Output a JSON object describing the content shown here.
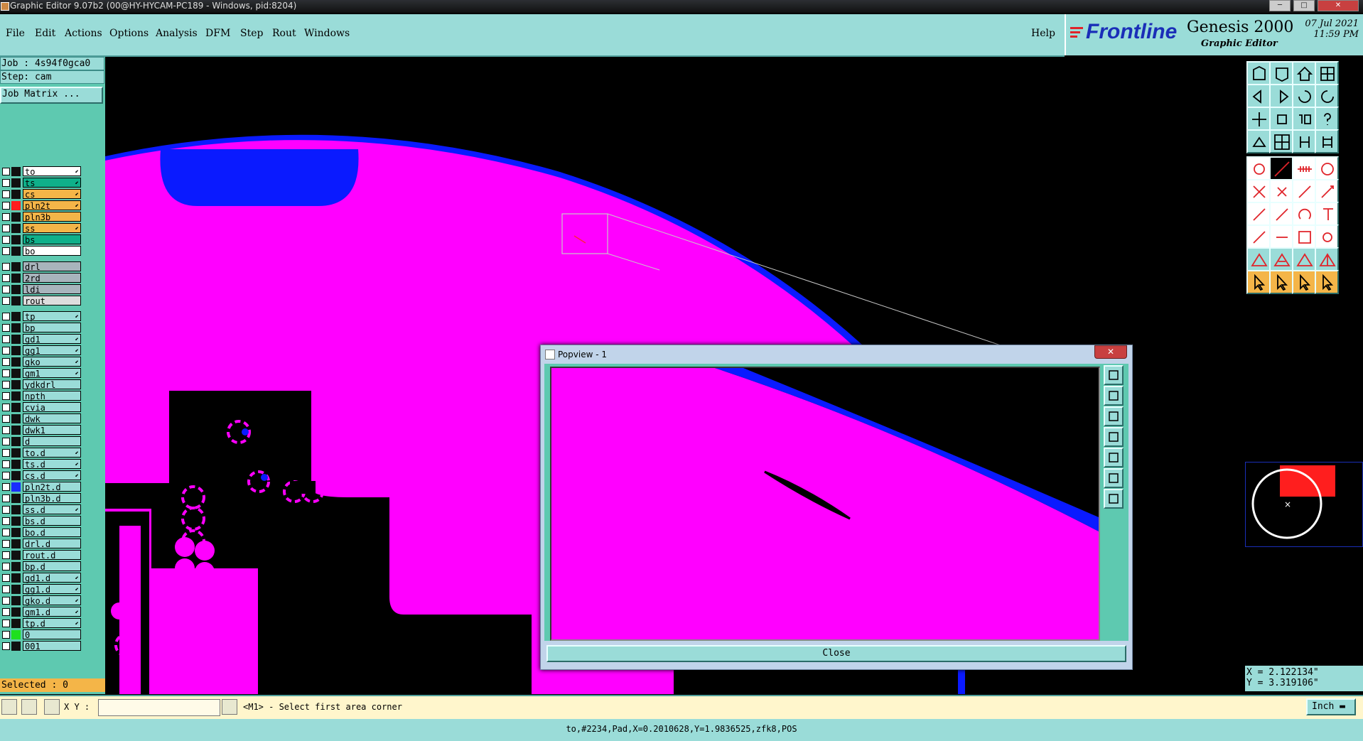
{
  "window": {
    "title": "Graphic Editor 9.07b2 (00@HY-HYCAM-PC189 - Windows, pid:8204)",
    "controls": [
      "─",
      "□",
      "✕"
    ]
  },
  "menu": {
    "items": [
      "File",
      "Edit",
      "Actions",
      "Options",
      "Analysis",
      "DFM",
      "Step",
      "Rout",
      "Windows"
    ],
    "help": "Help"
  },
  "brand": {
    "logo": "Frontline",
    "product": "Genesis 2000",
    "subtitle": "Graphic Editor",
    "date": "07 Jul 2021",
    "time": "11:59 PM"
  },
  "info": {
    "job": "Job : 4s94f0gca0",
    "step": "Step: cam",
    "matrix_button": "Job Matrix ..."
  },
  "layers": [
    {
      "name": "to",
      "color": "#ffffff",
      "swatch": "#111111",
      "arrow": true
    },
    {
      "name": "ts",
      "color": "#0fb08a",
      "swatch": "#111111",
      "arrow": true
    },
    {
      "name": "cs",
      "color": "#f4b548",
      "swatch": "#111111",
      "arrow": true
    },
    {
      "name": "pln2t",
      "color": "#f4b548",
      "swatch": "#ff1e1e",
      "arrow": true
    },
    {
      "name": "pln3b",
      "color": "#f4b548",
      "swatch": "#111111",
      "arrow": false
    },
    {
      "name": "ss",
      "color": "#f4b548",
      "swatch": "#111111",
      "arrow": true
    },
    {
      "name": "bs",
      "color": "#0fb08a",
      "swatch": "#111111",
      "arrow": false
    },
    {
      "name": "bo",
      "color": "#ffffff",
      "swatch": "#111111",
      "arrow": false
    },
    {
      "name": "drl",
      "color": "#a8b4bc",
      "swatch": "#111111",
      "arrow": false
    },
    {
      "name": "2rd",
      "color": "#a8b4bc",
      "swatch": "#111111",
      "arrow": false
    },
    {
      "name": "ldi",
      "color": "#a8b4bc",
      "swatch": "#111111",
      "arrow": false
    },
    {
      "name": "rout",
      "color": "#dddddd",
      "swatch": "#111111",
      "arrow": false
    },
    {
      "name": "tp",
      "color": "#9adcd8",
      "swatch": "#111111",
      "arrow": true
    },
    {
      "name": "bp",
      "color": "#9adcd8",
      "swatch": "#111111",
      "arrow": false
    },
    {
      "name": "gd1",
      "color": "#9adcd8",
      "swatch": "#111111",
      "arrow": true
    },
    {
      "name": "gg1",
      "color": "#9adcd8",
      "swatch": "#111111",
      "arrow": true
    },
    {
      "name": "gko",
      "color": "#9adcd8",
      "swatch": "#111111",
      "arrow": true
    },
    {
      "name": "gm1",
      "color": "#9adcd8",
      "swatch": "#111111",
      "arrow": true
    },
    {
      "name": "ydkdrl",
      "color": "#9adcd8",
      "swatch": "#111111",
      "arrow": false
    },
    {
      "name": "npth",
      "color": "#9adcd8",
      "swatch": "#111111",
      "arrow": false
    },
    {
      "name": "cvia",
      "color": "#9adcd8",
      "swatch": "#111111",
      "arrow": false
    },
    {
      "name": "dwk",
      "color": "#9adcd8",
      "swatch": "#111111",
      "arrow": false
    },
    {
      "name": "dwk1",
      "color": "#9adcd8",
      "swatch": "#111111",
      "arrow": false
    },
    {
      "name": "d",
      "color": "#9adcd8",
      "swatch": "#111111",
      "arrow": false
    },
    {
      "name": "to.d",
      "color": "#9adcd8",
      "swatch": "#111111",
      "arrow": true
    },
    {
      "name": "ts.d",
      "color": "#9adcd8",
      "swatch": "#111111",
      "arrow": true
    },
    {
      "name": "cs.d",
      "color": "#9adcd8",
      "swatch": "#111111",
      "arrow": true
    },
    {
      "name": "pln2t.d",
      "color": "#9adcd8",
      "swatch": "#1a2eff",
      "arrow": false
    },
    {
      "name": "pln3b.d",
      "color": "#9adcd8",
      "swatch": "#111111",
      "arrow": false
    },
    {
      "name": "ss.d",
      "color": "#9adcd8",
      "swatch": "#111111",
      "arrow": true
    },
    {
      "name": "bs.d",
      "color": "#9adcd8",
      "swatch": "#111111",
      "arrow": false
    },
    {
      "name": "bo.d",
      "color": "#9adcd8",
      "swatch": "#111111",
      "arrow": false
    },
    {
      "name": "drl.d",
      "color": "#9adcd8",
      "swatch": "#111111",
      "arrow": false
    },
    {
      "name": "rout.d",
      "color": "#9adcd8",
      "swatch": "#111111",
      "arrow": false
    },
    {
      "name": "bp.d",
      "color": "#9adcd8",
      "swatch": "#111111",
      "arrow": false
    },
    {
      "name": "gd1.d",
      "color": "#9adcd8",
      "swatch": "#111111",
      "arrow": true
    },
    {
      "name": "gg1.d",
      "color": "#9adcd8",
      "swatch": "#111111",
      "arrow": true
    },
    {
      "name": "gko.d",
      "color": "#9adcd8",
      "swatch": "#111111",
      "arrow": true
    },
    {
      "name": "gm1.d",
      "color": "#9adcd8",
      "swatch": "#111111",
      "arrow": true
    },
    {
      "name": "tp.d",
      "color": "#9adcd8",
      "swatch": "#111111",
      "arrow": true
    },
    {
      "name": "0",
      "color": "#9adcd8",
      "swatch": "#1ee01e",
      "arrow": false
    },
    {
      "name": "001",
      "color": "#9adcd8",
      "swatch": "#111111",
      "arrow": false
    }
  ],
  "selected": "Selected : 0",
  "coords": {
    "x": "X = 2.122134\"",
    "y": "Y = 3.319106\""
  },
  "command": {
    "xy_label": "X Y :",
    "xy_value": "",
    "prompt": "<M1> - Select first area corner",
    "units": "Inch"
  },
  "status": "to,#2234,Pad,X=0.2010628,Y=1.9836525,zfk8,POS",
  "popview": {
    "title": "Popview - 1",
    "close_label": "Close",
    "close_x": "✕"
  },
  "colors": {
    "copper": "#ff00ff",
    "blue": "#0a1aff",
    "panel": "#9adcd8",
    "accent": "#5ec9b0",
    "orange": "#f4b548"
  },
  "toolbar_icons": [
    "open-job-icon",
    "save-icon",
    "home-icon",
    "split-view-icon",
    "zoom-back-icon",
    "zoom-forward-icon",
    "undo-view-icon",
    "redo-view-icon",
    "zoom-fit-icon",
    "zoom-home-icon",
    "zoom-1to1-icon",
    "help-icon",
    "measure-icon",
    "grid-icon",
    "snap-net-icon",
    "snap-net-alt-icon",
    "add-pad-icon",
    "feature-filter-icon",
    "ruler-icon",
    "drill-icon",
    "connect-icon",
    "cross-icon",
    "line-pad-icon",
    "line-pad-alt-icon",
    "add-line-icon",
    "slash-icon",
    "arc-icon",
    "text-icon",
    "pad-line-icon",
    "dash-icon",
    "bbox-icon",
    "select-pad-icon",
    "polygon-icon",
    "polygon-alt-icon",
    "polygon-filled-icon",
    "polygon-edit-icon",
    "select-arrow-icon",
    "select-box-icon",
    "select-lasso-icon",
    "select-multi-icon"
  ]
}
